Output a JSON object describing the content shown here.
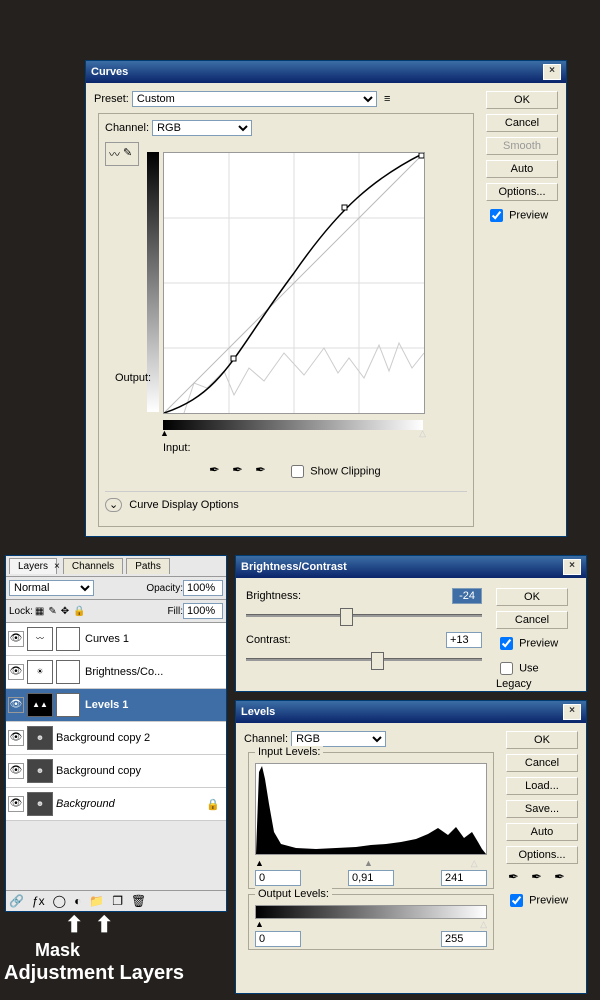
{
  "curves": {
    "title": "Curves",
    "preset_label": "Preset:",
    "preset_value": "Custom",
    "channel_label": "Channel:",
    "channel_value": "RGB",
    "output_label": "Output:",
    "input_label": "Input:",
    "show_clipping_label": "Show Clipping",
    "display_options": "Curve Display Options",
    "ok": "OK",
    "cancel": "Cancel",
    "smooth": "Smooth",
    "auto": "Auto",
    "options": "Options...",
    "preview": "Preview"
  },
  "bc": {
    "title": "Brightness/Contrast",
    "brightness_label": "Brightness:",
    "brightness_value": "-24",
    "contrast_label": "Contrast:",
    "contrast_value": "+13",
    "ok": "OK",
    "cancel": "Cancel",
    "preview": "Preview",
    "legacy": "Use Legacy"
  },
  "levels": {
    "title": "Levels",
    "channel_label": "Channel:",
    "channel_value": "RGB",
    "input_label": "Input Levels:",
    "output_label": "Output Levels:",
    "in_black": "0",
    "in_gamma": "0,91",
    "in_white": "241",
    "out_black": "0",
    "out_white": "255",
    "ok": "OK",
    "cancel": "Cancel",
    "load": "Load...",
    "save": "Save...",
    "auto": "Auto",
    "options": "Options...",
    "preview": "Preview"
  },
  "layersPanel": {
    "tabs": [
      "Layers",
      "Channels",
      "Paths"
    ],
    "blend": "Normal",
    "opacity_label": "Opacity:",
    "opacity": "100%",
    "lock_label": "Lock:",
    "fill_label": "Fill:",
    "fill": "100%",
    "rows": [
      {
        "name": "Curves 1",
        "sel": false
      },
      {
        "name": "Brightness/Co...",
        "sel": false
      },
      {
        "name": "Levels 1",
        "sel": true
      },
      {
        "name": "Background copy 2",
        "sel": false
      },
      {
        "name": "Background copy",
        "sel": false
      },
      {
        "name": "Background",
        "sel": false,
        "italic": true
      }
    ]
  },
  "annot": {
    "mask": "Mask",
    "adj": "Adjustment Layers"
  }
}
